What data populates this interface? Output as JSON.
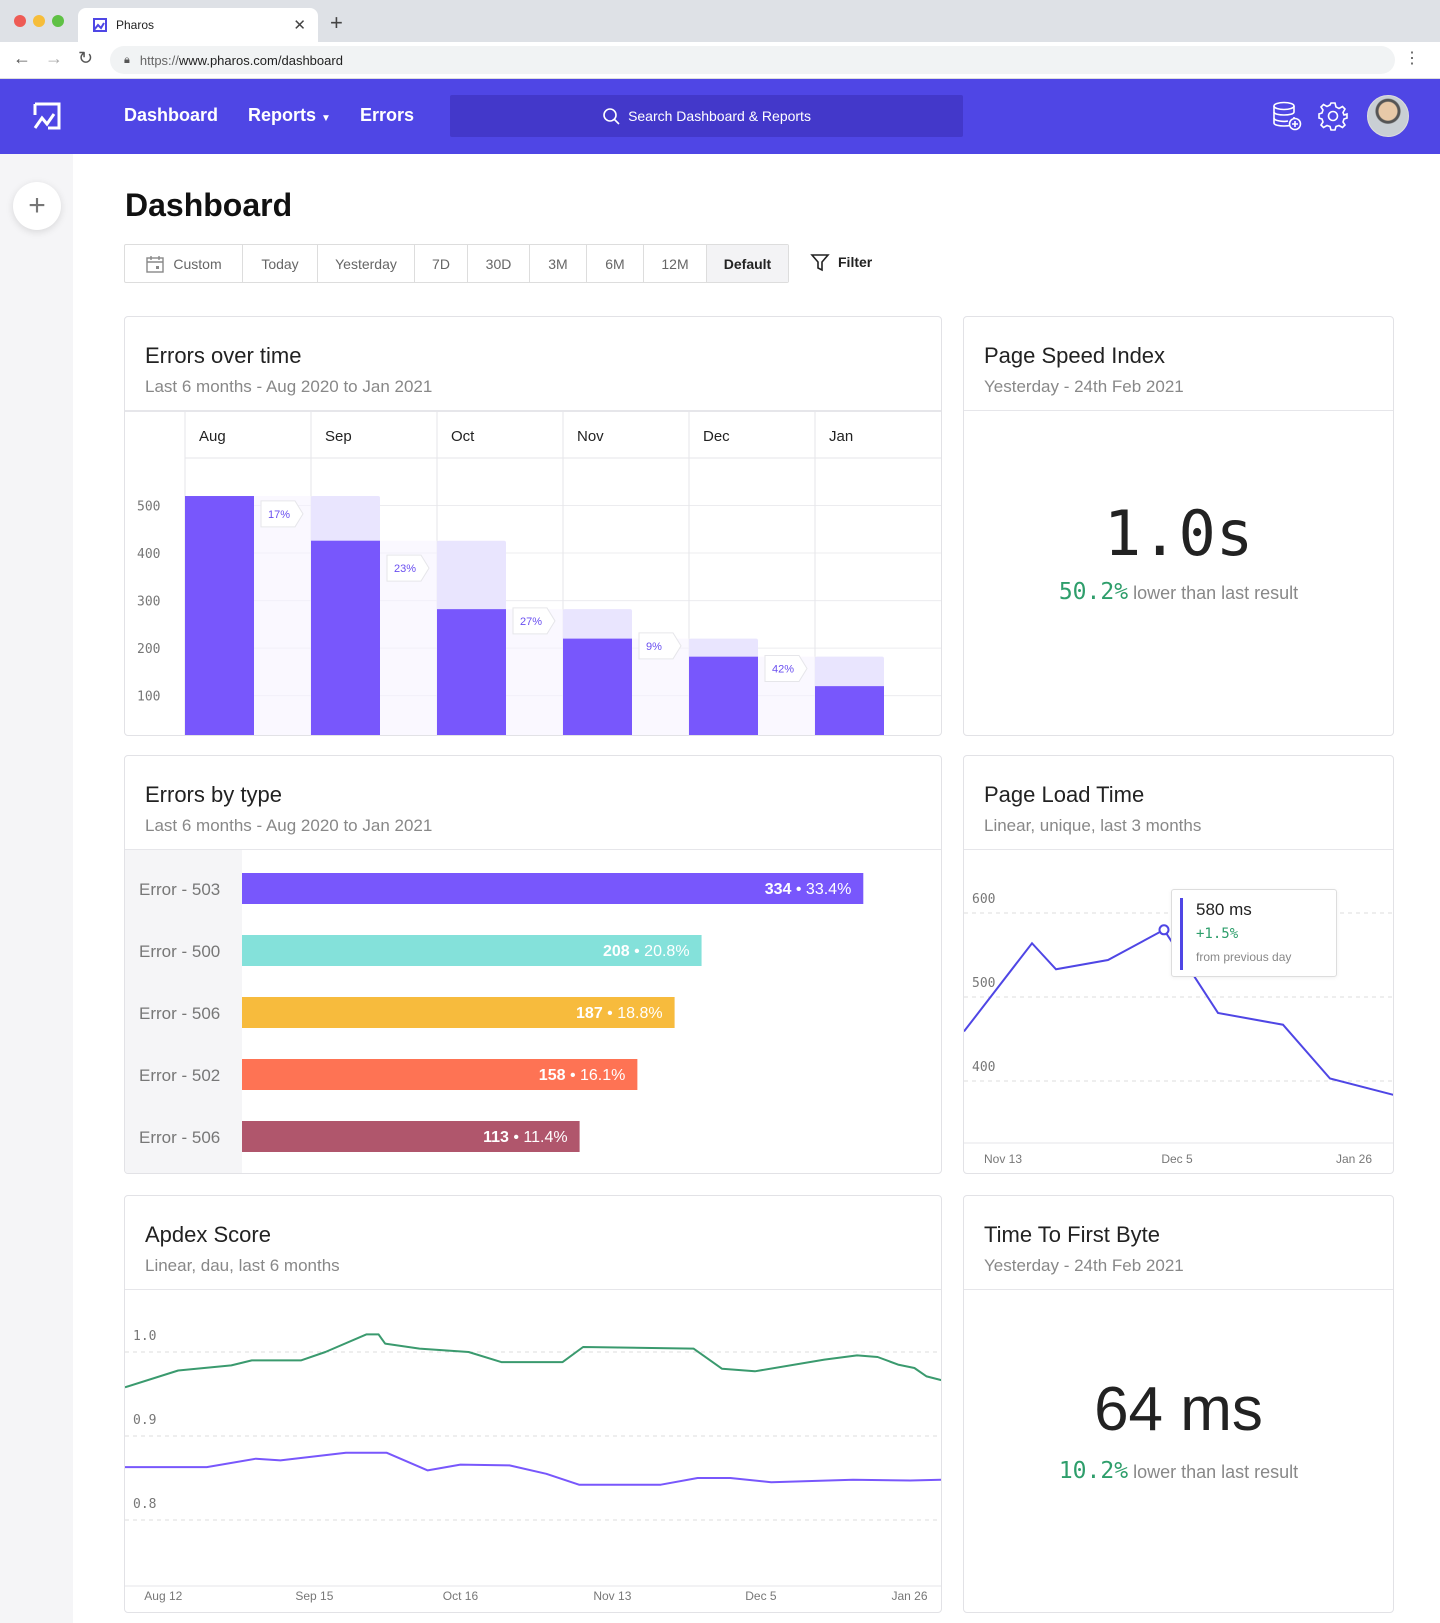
{
  "browser": {
    "tab_title": "Pharos",
    "url_proto": "https://",
    "url_rest": "www.pharos.com/dashboard"
  },
  "nav": {
    "links": [
      "Dashboard",
      "Reports",
      "Errors"
    ],
    "search_placeholder": "Search Dashboard & Reports",
    "icons": [
      "database-add-icon",
      "gear-icon",
      "avatar"
    ],
    "color": "#4f46e5"
  },
  "page": {
    "title": "Dashboard"
  },
  "ranges": {
    "options": [
      "Custom",
      "Today",
      "Yesterday",
      "7D",
      "30D",
      "3M",
      "6M",
      "12M",
      "Default"
    ],
    "selected": "Default",
    "filter_label": "Filter"
  },
  "errors_over_time": {
    "title": "Errors over time",
    "subtitle": "Last 6 months - Aug 2020 to Jan 2021"
  },
  "page_speed": {
    "title": "Page Speed Index",
    "subtitle": "Yesterday - 24th Feb 2021",
    "value": "1.0s",
    "change": "50.2%",
    "change_text": "lower than last result"
  },
  "errors_by_type": {
    "title": "Errors by type",
    "subtitle": "Last 6 months - Aug 2020 to Jan 2021"
  },
  "page_load": {
    "title": "Page Load Time",
    "subtitle": "Linear, unique, last 3 months",
    "tooltip": {
      "value": "580 ms",
      "change": "+1.5%",
      "note": "from previous day"
    }
  },
  "apdex": {
    "title": "Apdex Score",
    "subtitle": "Linear, dau, last 6 months"
  },
  "ttfb": {
    "title": "Time To First Byte",
    "subtitle": "Yesterday - 24th Feb 2021",
    "value": "64 ms",
    "change": "10.2%",
    "change_text": "lower than last result"
  },
  "chart_data": [
    {
      "type": "bar",
      "categories": [
        "Aug",
        "Sep",
        "Oct",
        "Nov",
        "Dec",
        "Jan"
      ],
      "values": [
        520,
        426,
        282,
        220,
        182,
        120
      ],
      "changes": [
        "17%",
        "23%",
        "27%",
        "9%",
        "42%"
      ],
      "yticks": [
        100,
        200,
        300,
        400,
        500
      ],
      "ylim": [
        13,
        600
      ],
      "color": "#7857fc",
      "ghost_color": "#e9e5fe",
      "grid": true
    },
    {
      "type": "bar",
      "orientation": "horizontal",
      "categories": [
        "Error - 503",
        "Error - 500",
        "Error - 506",
        "Error - 502",
        "Error - 506"
      ],
      "values": [
        334,
        208,
        187,
        158,
        113
      ],
      "labels": [
        "33.4%",
        "20.8%",
        "18.8%",
        "16.1%",
        "11.4%"
      ],
      "colors": [
        "#7857fc",
        "#84e1da",
        "#f7bb3d",
        "#fe7354",
        "#b0566c"
      ]
    },
    {
      "type": "line",
      "xticks": [
        "Nov 13",
        "Dec 5",
        "Jan 26"
      ],
      "yticks": [
        400,
        500,
        600
      ],
      "values": [
        459,
        564,
        533,
        544,
        580,
        481,
        467,
        403,
        383
      ],
      "highlight_value": 580,
      "color": "#4f46e5",
      "grid": true
    },
    {
      "type": "line",
      "xticks": [
        "Aug 12",
        "Sep 15",
        "Oct 16",
        "Nov 13",
        "Dec 5",
        "Jan 26"
      ],
      "yticks": [
        "1.0",
        "0.9",
        "0.8"
      ],
      "series": [
        {
          "color": "#3a9a6e",
          "values": [
            0.958,
            0.978,
            0.984,
            0.99,
            0.99,
            1.0,
            1.021,
            1.021,
            1.01,
            1.004,
            1.0,
            0.988,
            0.988,
            1.006,
            1.004,
            0.98,
            0.977,
            0.991,
            0.996,
            0.994,
            0.985,
            0.981,
            0.971,
            0.966
          ]
        },
        {
          "color": "#7857fc",
          "values": [
            0.863,
            0.863,
            0.873,
            0.871,
            0.88,
            0.88,
            0.859,
            0.866,
            0.865,
            0.855,
            0.842,
            0.842,
            0.85,
            0.85,
            0.845,
            0.848,
            0.847,
            0.848
          ]
        }
      ],
      "grid": true
    }
  ]
}
